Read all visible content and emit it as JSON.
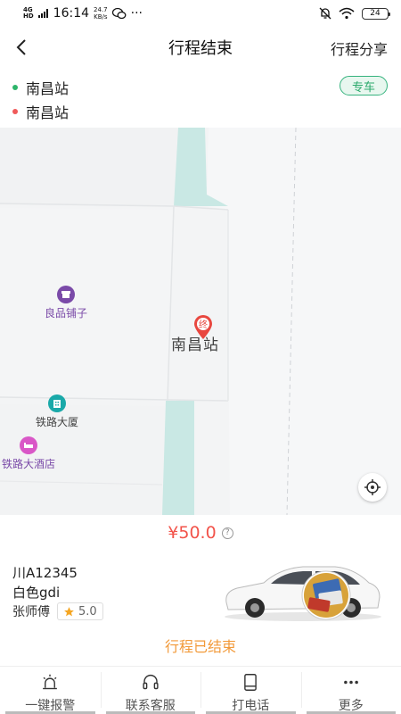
{
  "status_bar": {
    "network": "4G",
    "network_sub": "HD",
    "time": "16:14",
    "speed_value": "24.7",
    "speed_unit": "KB/s",
    "more": "···",
    "battery": "24"
  },
  "header": {
    "title": "行程结束",
    "share_label": "行程分享"
  },
  "route": {
    "start": "南昌站",
    "end": "南昌站",
    "ride_type": "专车"
  },
  "map": {
    "pois": [
      "良品铺子",
      "铁路大厦",
      "铁路大酒店"
    ],
    "end_marker_text": "终",
    "station_label": "南昌站"
  },
  "fare": {
    "amount": "¥50.0",
    "info_icon": "?"
  },
  "driver": {
    "plate": "川A12345",
    "car": "白色gdi",
    "name": "张师傅",
    "rating": "5.0"
  },
  "trip_status": "行程已结束",
  "bottom_bar": {
    "items": [
      "一键报警",
      "联系客服",
      "打电话",
      "更多"
    ]
  },
  "colors": {
    "accent_red": "#f2534a",
    "ride_type_green": "#2aa96b",
    "status_orange": "#f29a3a",
    "poi_purple": "#7a4aa8",
    "poi_teal": "#1aa9a9",
    "poi_pink": "#d957c7",
    "map_water": "#c9e8e4"
  },
  "icons": {
    "back": "chevron-left-icon",
    "info": "question-circle-icon",
    "locate": "crosshair-icon",
    "star": "star-icon",
    "alarm": "alarm-light-icon",
    "service": "headset-icon",
    "phone": "phone-icon",
    "more": "dots-icon"
  }
}
